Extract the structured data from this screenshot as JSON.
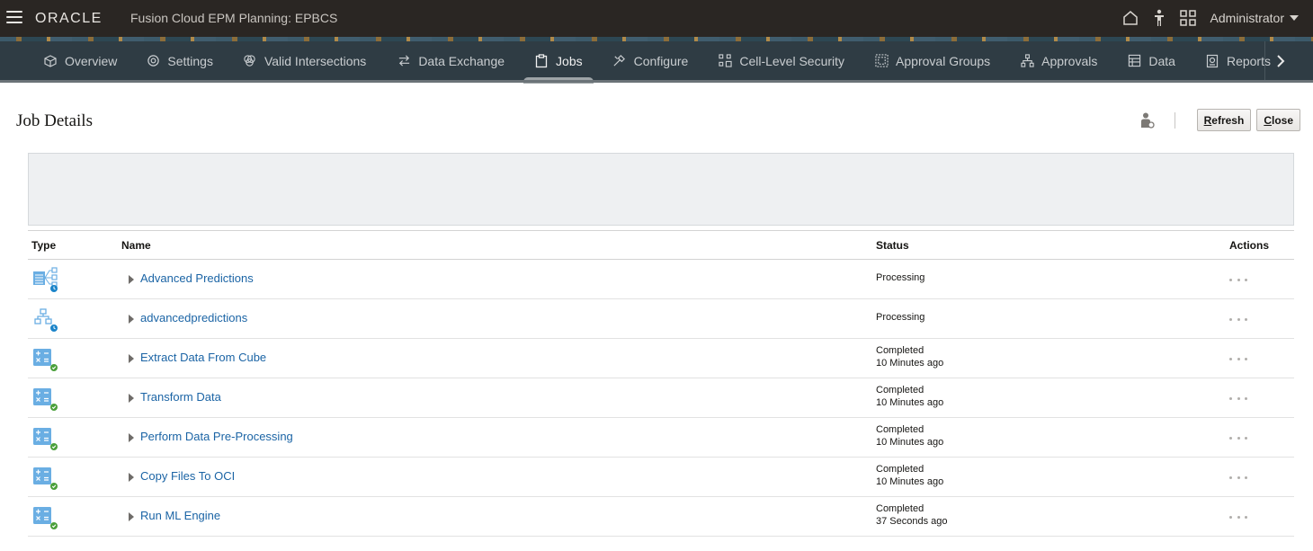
{
  "topbar": {
    "logo": "ORACLE",
    "app_title": "Fusion Cloud EPM Planning:  EPBCS",
    "user": "Administrator"
  },
  "nav": {
    "items": [
      {
        "label": "Overview",
        "icon": "cube-icon"
      },
      {
        "label": "Settings",
        "icon": "gear-icon"
      },
      {
        "label": "Valid Intersections",
        "icon": "intersections-icon"
      },
      {
        "label": "Data Exchange",
        "icon": "exchange-icon"
      },
      {
        "label": "Jobs",
        "icon": "clipboard-icon",
        "active": true
      },
      {
        "label": "Configure",
        "icon": "tools-icon"
      },
      {
        "label": "Cell-Level Security",
        "icon": "cell-security-icon"
      },
      {
        "label": "Approval Groups",
        "icon": "approval-groups-icon"
      },
      {
        "label": "Approvals",
        "icon": "approvals-icon"
      },
      {
        "label": "Data",
        "icon": "data-grid-icon"
      },
      {
        "label": "Reports",
        "icon": "reports-icon"
      }
    ]
  },
  "page": {
    "title": "Job Details",
    "refresh_hotkey": "R",
    "refresh_rest": "efresh",
    "close_hotkey": "C",
    "close_rest": "lose"
  },
  "table": {
    "headers": {
      "type": "Type",
      "name": "Name",
      "status": "Status",
      "actions": "Actions"
    },
    "rows": [
      {
        "icon": "prediction-processing-icon",
        "name": "Advanced Predictions",
        "status": "Processing",
        "time": ""
      },
      {
        "icon": "pipeline-processing-icon",
        "name": "advancedpredictions",
        "status": "Processing",
        "time": ""
      },
      {
        "icon": "calc-completed-icon",
        "name": "Extract Data From Cube",
        "status": "Completed",
        "time": "10 Minutes ago"
      },
      {
        "icon": "calc-completed-icon",
        "name": "Transform Data",
        "status": "Completed",
        "time": "10 Minutes ago"
      },
      {
        "icon": "calc-completed-icon",
        "name": "Perform Data Pre-Processing",
        "status": "Completed",
        "time": "10 Minutes ago"
      },
      {
        "icon": "calc-completed-icon",
        "name": "Copy Files To OCI",
        "status": "Completed",
        "time": "10 Minutes ago"
      },
      {
        "icon": "calc-completed-icon",
        "name": "Run ML Engine",
        "status": "Completed",
        "time": "37 Seconds ago"
      }
    ]
  },
  "colors": {
    "topbar": "#2a2623",
    "navbar": "#2f3c44",
    "link": "#1b64a5",
    "icon_blue": "#6aaee3",
    "badge_processing": "#1b84c9",
    "badge_completed": "#4ba03b"
  }
}
